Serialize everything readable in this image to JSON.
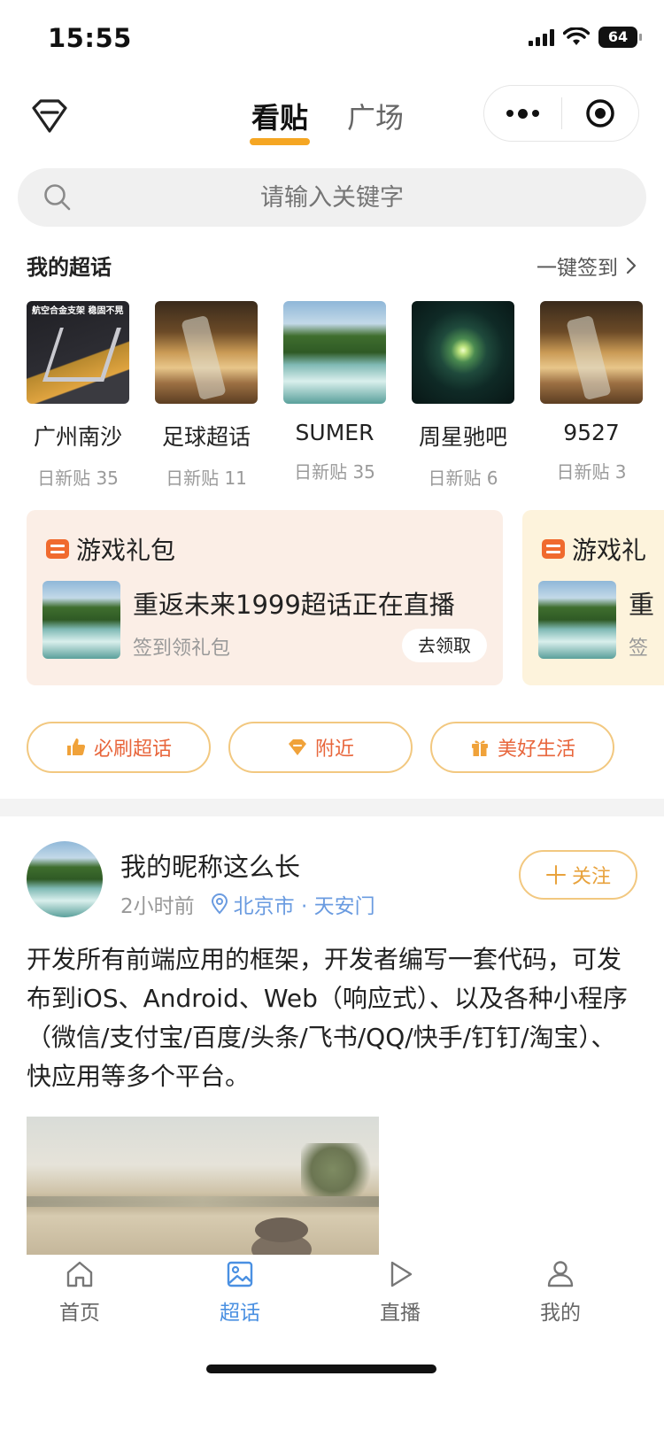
{
  "status_bar": {
    "time": "15:55",
    "battery": "64"
  },
  "top_nav": {
    "tabs": [
      {
        "label": "看贴",
        "active": true
      },
      {
        "label": "广场",
        "active": false
      }
    ]
  },
  "search": {
    "placeholder": "请输入关键字"
  },
  "my_topics": {
    "title": "我的超话",
    "checkin_label": "一键签到",
    "items": [
      {
        "name": "广州南沙",
        "count": "日新贴 35",
        "thumb_text": "航空合金支架 稳固不晃"
      },
      {
        "name": "足球超话",
        "count": "日新贴 11"
      },
      {
        "name": "SUMER",
        "count": "日新贴 35"
      },
      {
        "name": "周星驰吧",
        "count": "日新贴 6"
      },
      {
        "name": "9527",
        "count": "日新贴 3"
      }
    ]
  },
  "gift_cards": [
    {
      "header": "游戏礼包",
      "title": "重返未来1999超话正在直播",
      "subtitle": "签到领礼包",
      "button": "去领取"
    },
    {
      "header": "游戏礼",
      "title": "重",
      "subtitle": "签"
    }
  ],
  "pills": [
    {
      "label": "必刷超话",
      "icon": "thumbs-up-icon"
    },
    {
      "label": "附近",
      "icon": "location-diamond-icon"
    },
    {
      "label": "美好生活",
      "icon": "gift-icon"
    }
  ],
  "post": {
    "author": "我的昵称这么长",
    "time": "2小时前",
    "location": "北京市 · 天安门",
    "follow_label": "关注",
    "content": "开发所有前端应用的框架，开发者编写一套代码，可发布到iOS、Android、Web（响应式）、以及各种小程序（微信/支付宝/百度/头条/飞书/QQ/快手/钉钉/淘宝）、快应用等多个平台。"
  },
  "tab_bar": [
    {
      "label": "首页",
      "icon": "home-icon",
      "active": false
    },
    {
      "label": "超话",
      "icon": "image-icon",
      "active": true
    },
    {
      "label": "直播",
      "icon": "play-icon",
      "active": false
    },
    {
      "label": "我的",
      "icon": "user-icon",
      "active": false
    }
  ],
  "colors": {
    "accent": "#f5a623",
    "active_tab": "#4a90e2",
    "pill_text": "#e8663c",
    "location": "#6a9be0"
  }
}
